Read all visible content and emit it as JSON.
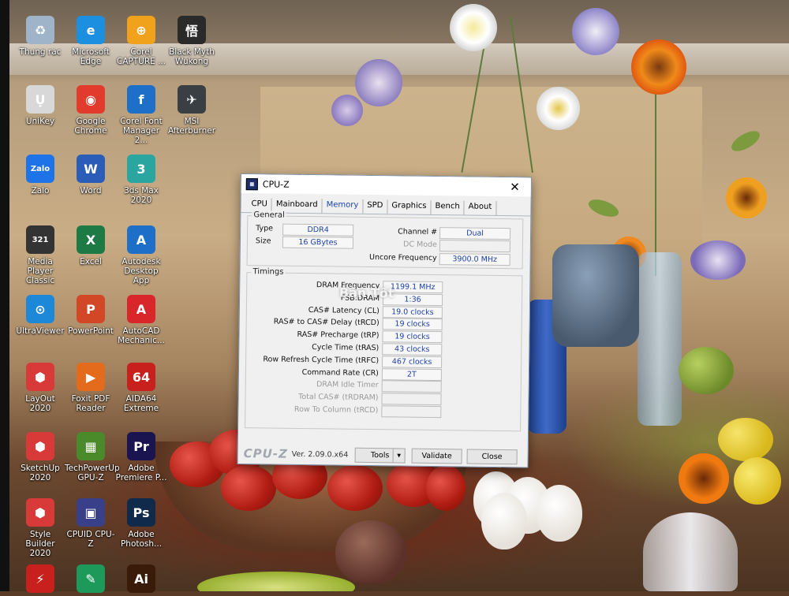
{
  "desktop_icons": [
    {
      "label": "Thung rac",
      "icon": "recycle-bin-icon",
      "color": "#9fb4c8"
    },
    {
      "label": "Microsoft Edge",
      "icon": "edge-icon",
      "color": "#1d8fe0"
    },
    {
      "label": "Corel CAPTURE ...",
      "icon": "corel-capture-icon",
      "color": "#f0a21d"
    },
    {
      "label": "Black Myth Wukong",
      "icon": "black-myth-icon",
      "color": "#2a2a2a"
    },
    {
      "label": "UniKey",
      "icon": "unikey-icon",
      "color": "#d8d8d8"
    },
    {
      "label": "Google Chrome",
      "icon": "chrome-icon",
      "color": "#e23b2e"
    },
    {
      "label": "Corel Font Manager 2...",
      "icon": "corel-font-icon",
      "color": "#1e6fc8"
    },
    {
      "label": "MSI Afterburner",
      "icon": "msi-afterburner-icon",
      "color": "#3a3f44"
    },
    {
      "label": "Zalo",
      "icon": "zalo-icon",
      "color": "#1e73e8"
    },
    {
      "label": "Word",
      "icon": "word-icon",
      "color": "#2b5cb8"
    },
    {
      "label": "3ds Max 2020",
      "icon": "3dsmax-icon",
      "color": "#2aa5a0"
    },
    {
      "label": "Media Player Classic",
      "icon": "media-player-icon",
      "color": "#333333"
    },
    {
      "label": "Excel",
      "icon": "excel-icon",
      "color": "#1d7a45"
    },
    {
      "label": "Autodesk Desktop App",
      "icon": "autodesk-icon",
      "color": "#1d6fc8"
    },
    {
      "label": "UltraViewer",
      "icon": "ultraviewer-icon",
      "color": "#1e88d8"
    },
    {
      "label": "PowerPoint",
      "icon": "powerpoint-icon",
      "color": "#d24726"
    },
    {
      "label": "AutoCAD Mechanic...",
      "icon": "autocad-icon",
      "color": "#d8262b"
    },
    {
      "label": "LayOut 2020",
      "icon": "layout-icon",
      "color": "#d83a3a"
    },
    {
      "label": "Foxit PDF Reader",
      "icon": "foxit-icon",
      "color": "#e46a1c"
    },
    {
      "label": "AIDA64 Extreme",
      "icon": "aida64-icon",
      "color": "#c8201c"
    },
    {
      "label": "SketchUp 2020",
      "icon": "sketchup-icon",
      "color": "#d83a3a"
    },
    {
      "label": "TechPowerUp GPU-Z",
      "icon": "gpuz-icon",
      "color": "#4a8a2a"
    },
    {
      "label": "Adobe Premiere P...",
      "icon": "premiere-icon",
      "color": "#1a1450"
    },
    {
      "label": "Style Builder 2020",
      "icon": "style-builder-icon",
      "color": "#d83a3a"
    },
    {
      "label": "CPUID CPU-Z",
      "icon": "cpuz-icon",
      "color": "#3a3f8a"
    },
    {
      "label": "Adobe Photosh...",
      "icon": "photoshop-icon",
      "color": "#0f2a4a"
    },
    {
      "label": "",
      "icon": "app-red-icon",
      "color": "#c8201c"
    },
    {
      "label": "",
      "icon": "app-green-icon",
      "color": "#1d9a5a"
    },
    {
      "label": "",
      "icon": "illustrator-icon",
      "color": "#3a1a08"
    }
  ],
  "icon_glyphs": [
    "♻",
    "e",
    "⊕",
    "悟",
    "Ụ",
    "◉",
    "f",
    "✈",
    "Zalo",
    "W",
    "3",
    "321",
    "X",
    "A",
    "⊙",
    "P",
    "A",
    "⬢",
    "▶",
    "64",
    "⬢",
    "▦",
    "Pr",
    "⬢",
    "▣",
    "Ps",
    "⚡",
    "✎",
    "Ai"
  ],
  "cpuz": {
    "title": "CPU-Z",
    "tabs": [
      "CPU",
      "Mainboard",
      "Memory",
      "SPD",
      "Graphics",
      "Bench",
      "About"
    ],
    "active_tab": "Memory",
    "general": {
      "legend": "General",
      "type_label": "Type",
      "type_value": "DDR4",
      "size_label": "Size",
      "size_value": "16 GBytes",
      "channel_label": "Channel #",
      "channel_value": "Dual",
      "dc_mode_label": "DC Mode",
      "dc_mode_value": "",
      "uncore_label": "Uncore Frequency",
      "uncore_value": "3900.0 MHz"
    },
    "timings": {
      "legend": "Timings",
      "rows": [
        {
          "label": "DRAM Frequency",
          "value": "1199.1 MHz",
          "dim": false
        },
        {
          "label": "FSB:DRAM",
          "value": "1:36",
          "dim": false
        },
        {
          "label": "CAS# Latency (CL)",
          "value": "19.0 clocks",
          "dim": false
        },
        {
          "label": "RAS# to CAS# Delay (tRCD)",
          "value": "19 clocks",
          "dim": false
        },
        {
          "label": "RAS# Precharge (tRP)",
          "value": "19 clocks",
          "dim": false
        },
        {
          "label": "Cycle Time (tRAS)",
          "value": "43 clocks",
          "dim": false
        },
        {
          "label": "Row Refresh Cycle Time (tRFC)",
          "value": "467 clocks",
          "dim": false
        },
        {
          "label": "Command Rate (CR)",
          "value": "2T",
          "dim": false
        },
        {
          "label": "DRAM Idle Timer",
          "value": "",
          "dim": true
        },
        {
          "label": "Total CAS# (tRDRAM)",
          "value": "",
          "dim": true
        },
        {
          "label": "Row To Column (tRCD)",
          "value": "",
          "dim": true
        }
      ]
    },
    "footer": {
      "brand": "CPU-Z",
      "version": "Ver. 2.09.0.x64",
      "tools_label": "Tools",
      "validate_label": "Validate",
      "close_label": "Close"
    }
  },
  "watermark": "Bán Tốt"
}
